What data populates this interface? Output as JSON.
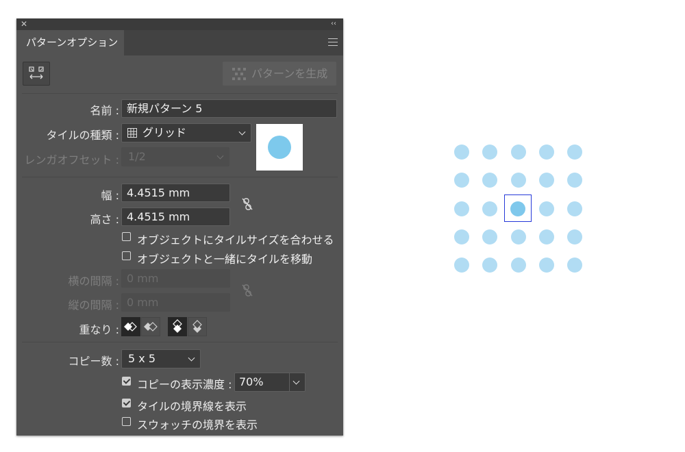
{
  "panel": {
    "title": "パターンオプション",
    "make_pattern_label": "パターンを生成",
    "name": {
      "label": "名前 :",
      "value": "新規パターン 5"
    },
    "tile_type": {
      "label": "タイルの種類 :",
      "value": "グリッド"
    },
    "brick_offset": {
      "label": "レンガオフセット :",
      "value": "1/2"
    },
    "width": {
      "label": "幅 :",
      "value": "4.4515 mm"
    },
    "height": {
      "label": "高さ :",
      "value": "4.4515 mm"
    },
    "size_tile_to_art": {
      "label": "オブジェクトにタイルサイズを合わせる",
      "checked": false
    },
    "move_tile_with_art": {
      "label": "オブジェクトと一緒にタイルを移動",
      "checked": false
    },
    "h_spacing": {
      "label": "横の間隔 :",
      "placeholder": "0 mm"
    },
    "v_spacing": {
      "label": "縦の間隔 :",
      "placeholder": "0 mm"
    },
    "overlap": {
      "label": "重なり :"
    },
    "copies": {
      "label": "コピー数 :",
      "value": "5 x 5"
    },
    "dim_copies": {
      "label": "コピーの表示濃度 :",
      "value": "70%",
      "checked": true
    },
    "show_tile_edge": {
      "label": "タイルの境界線を表示",
      "checked": true
    },
    "show_swatch_bounds": {
      "label": "スウォッチの境界を表示",
      "checked": false
    }
  },
  "icons": [
    "close-icon",
    "collapse-icon",
    "panel-menu-icon",
    "tile-edit-icon",
    "pattern-icon",
    "grid-icon",
    "chevron-down-icon",
    "link-broken-icon",
    "overlap-left-front-icon",
    "overlap-right-front-icon",
    "overlap-top-front-icon",
    "overlap-bottom-front-icon"
  ],
  "colors": {
    "panel_bg": "#535353",
    "pattern_dot": "#b1dcf3",
    "pattern_dot_center": "#7fc8ec",
    "tile_edge": "#2438d8"
  },
  "canvas": {
    "copies_rows": 5,
    "copies_cols": 5
  }
}
